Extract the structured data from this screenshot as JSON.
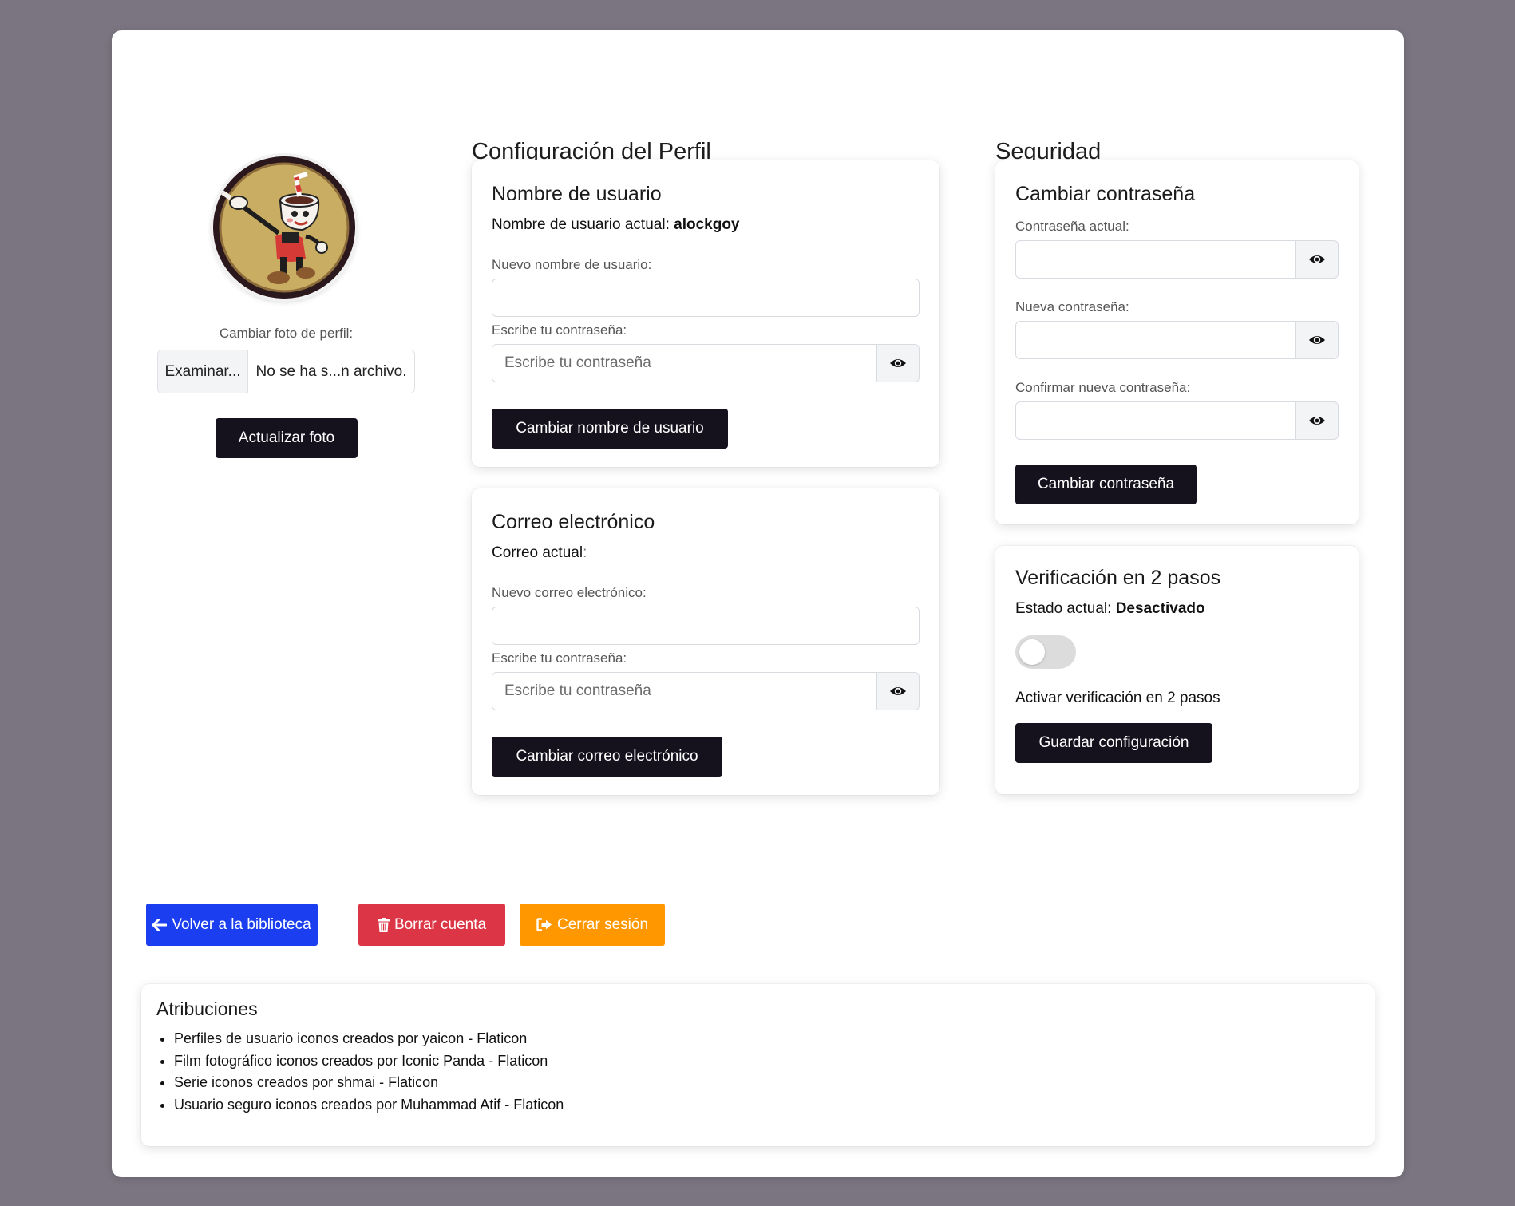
{
  "profile_column": {
    "change_photo_label": "Cambiar foto de perfil:",
    "file_button": "Examinar...",
    "file_name": "No se ha s...n archivo.",
    "update_photo_button": "Actualizar foto"
  },
  "profile_section": {
    "title": "Configuración del Perfil",
    "username_card": {
      "title": "Nombre de usuario",
      "current_label": "Nombre de usuario actual:",
      "current_value": "alockgoy",
      "new_label": "Nuevo nombre de usuario:",
      "new_value": "",
      "password_label": "Escribe tu contraseña:",
      "password_placeholder": "Escribe tu contraseña",
      "submit_button": "Cambiar nombre de usuario"
    },
    "email_card": {
      "title": "Correo electrónico",
      "current_label": "Correo actual",
      "current_colon": ":",
      "new_label": "Nuevo correo electrónico:",
      "new_value": "",
      "password_label": "Escribe tu contraseña:",
      "password_placeholder": "Escribe tu contraseña",
      "submit_button": "Cambiar correo electrónico"
    }
  },
  "security_section": {
    "title": "Seguridad",
    "password_card": {
      "title": "Cambiar contraseña",
      "current_label": "Contraseña actual:",
      "new_label": "Nueva contraseña:",
      "confirm_label": "Confirmar nueva contraseña:",
      "submit_button": "Cambiar contraseña"
    },
    "two_factor_card": {
      "title": "Verificación en 2 pasos",
      "status_label": "Estado actual:",
      "status_value": "Desactivado",
      "toggle_on": false,
      "toggle_label": "Activar verificación en 2 pasos",
      "save_button": "Guardar configuración"
    }
  },
  "actions": {
    "back_button": "Volver a la biblioteca",
    "back_color": "#1b3ff0",
    "delete_button": "Borrar cuenta",
    "delete_color": "#dc3545",
    "logout_button": "Cerrar sesión",
    "logout_color": "#ff9800"
  },
  "attributions": {
    "title": "Atribuciones",
    "items": [
      "Perfiles de usuario iconos creados por yaicon - Flaticon",
      "Film fotográfico iconos creados por Iconic Panda - Flaticon",
      "Serie iconos creados por shmai - Flaticon",
      "Usuario seguro iconos creados por Muhammad Atif - Flaticon"
    ]
  },
  "colors": {
    "page_background": "#7a7580",
    "dark_button": "#15121d"
  }
}
